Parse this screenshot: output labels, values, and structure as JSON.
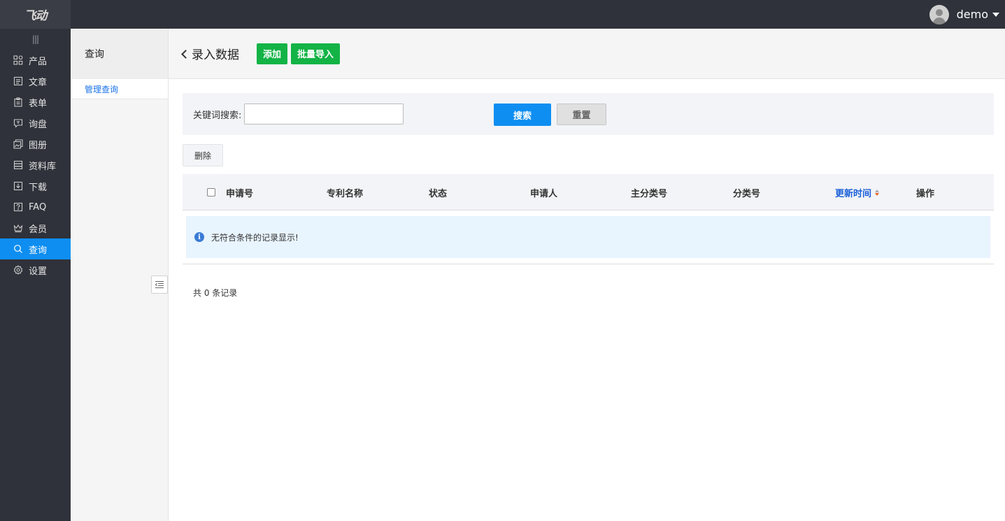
{
  "app": {
    "logo_text": "飞动"
  },
  "user": {
    "name": "demo"
  },
  "sidebar": {
    "toggle_glyph": "|||",
    "items": [
      {
        "label": "产品",
        "icon": "grid-icon"
      },
      {
        "label": "文章",
        "icon": "article-icon"
      },
      {
        "label": "表单",
        "icon": "form-icon"
      },
      {
        "label": "询盘",
        "icon": "inquiry-icon"
      },
      {
        "label": "图册",
        "icon": "gallery-icon"
      },
      {
        "label": "资料库",
        "icon": "database-icon"
      },
      {
        "label": "下载",
        "icon": "download-icon"
      },
      {
        "label": "FAQ",
        "icon": "faq-icon"
      },
      {
        "label": "会员",
        "icon": "crown-icon"
      },
      {
        "label": "查询",
        "icon": "search-icon",
        "active": true
      },
      {
        "label": "设置",
        "icon": "settings-icon"
      }
    ]
  },
  "subpanel": {
    "title": "查询",
    "link": "管理查询"
  },
  "header": {
    "title": "录入数据",
    "add_label": "添加",
    "import_label": "批量导入"
  },
  "search": {
    "label": "关键词搜索:",
    "value": "",
    "placeholder": "",
    "search_label": "搜索",
    "reset_label": "重置"
  },
  "toolbar": {
    "delete_label": "删除"
  },
  "table": {
    "columns": [
      "申请号",
      "专利名称",
      "状态",
      "申请人",
      "主分类号",
      "分类号",
      "更新时间",
      "操作"
    ],
    "sorted_column": "更新时间",
    "empty_message": "无符合条件的记录显示!",
    "info_glyph": "i"
  },
  "footer": {
    "total_text": "共 0 条记录"
  },
  "colors": {
    "accent_blue": "#0e8ef1",
    "green": "#13b346",
    "sidebar_bg": "#2f323a"
  }
}
